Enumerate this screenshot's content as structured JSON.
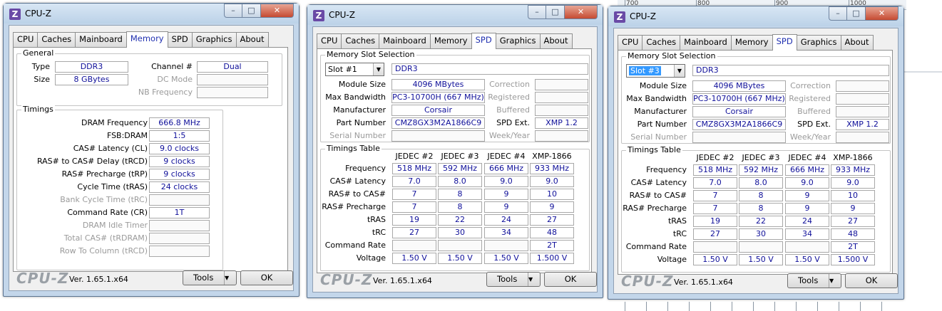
{
  "background": {
    "ruler_labels": [
      "700",
      "800",
      "900",
      "1000"
    ]
  },
  "windows": [
    {
      "title": "CPU-Z",
      "tabs": [
        "CPU",
        "Caches",
        "Mainboard",
        "Memory",
        "SPD",
        "Graphics",
        "About"
      ],
      "active_tab": "Memory",
      "general": {
        "label": "General",
        "type_label": "Type",
        "type_value": "DDR3",
        "size_label": "Size",
        "size_value": "8 GBytes",
        "channel_label": "Channel #",
        "channel_value": "Dual",
        "dc_mode_label": "DC Mode",
        "dc_mode_value": "",
        "nb_freq_label": "NB Frequency",
        "nb_freq_value": ""
      },
      "timings": {
        "label": "Timings",
        "rows": [
          {
            "label": "DRAM Frequency",
            "value": "666.8 MHz",
            "dim": false
          },
          {
            "label": "FSB:DRAM",
            "value": "1:5",
            "dim": false
          },
          {
            "label": "CAS# Latency (CL)",
            "value": "9.0 clocks",
            "dim": false
          },
          {
            "label": "RAS# to CAS# Delay (tRCD)",
            "value": "9 clocks",
            "dim": false
          },
          {
            "label": "RAS# Precharge (tRP)",
            "value": "9 clocks",
            "dim": false
          },
          {
            "label": "Cycle Time (tRAS)",
            "value": "24 clocks",
            "dim": false
          },
          {
            "label": "Bank Cycle Time (tRC)",
            "value": "",
            "dim": true
          },
          {
            "label": "Command Rate (CR)",
            "value": "1T",
            "dim": false
          },
          {
            "label": "DRAM Idle Timer",
            "value": "",
            "dim": true
          },
          {
            "label": "Total CAS# (tRDRAM)",
            "value": "",
            "dim": true
          },
          {
            "label": "Row To Column (tRCD)",
            "value": "",
            "dim": true
          }
        ]
      },
      "footer": {
        "logo": "CPU-Z",
        "version": "Ver. 1.65.1.x64",
        "tools_label": "Tools",
        "ok_label": "OK"
      }
    },
    {
      "title": "CPU-Z",
      "tabs": [
        "CPU",
        "Caches",
        "Mainboard",
        "Memory",
        "SPD",
        "Graphics",
        "About"
      ],
      "active_tab": "SPD",
      "slot_selection": {
        "label": "Memory Slot Selection",
        "slot_value": "Slot #1",
        "type_value": "DDR3",
        "module_size_label": "Module Size",
        "module_size_value": "4096 MBytes",
        "max_bw_label": "Max Bandwidth",
        "max_bw_value": "PC3-10700H (667 MHz)",
        "manufacturer_label": "Manufacturer",
        "manufacturer_value": "Corsair",
        "part_number_label": "Part Number",
        "part_number_value": "CMZ8GX3M2A1866C9",
        "serial_label": "Serial Number",
        "serial_value": "",
        "correction_label": "Correction",
        "correction_value": "",
        "registered_label": "Registered",
        "registered_value": "",
        "buffered_label": "Buffered",
        "buffered_value": "",
        "spd_ext_label": "SPD Ext.",
        "spd_ext_value": "XMP 1.2",
        "week_year_label": "Week/Year",
        "week_year_value": ""
      },
      "timings_table": {
        "label": "Timings Table",
        "columns": [
          "JEDEC #2",
          "JEDEC #3",
          "JEDEC #4",
          "XMP-1866"
        ],
        "rows": [
          {
            "label": "Frequency",
            "values": [
              "518 MHz",
              "592 MHz",
              "666 MHz",
              "933 MHz"
            ]
          },
          {
            "label": "CAS# Latency",
            "values": [
              "7.0",
              "8.0",
              "9.0",
              "9.0"
            ]
          },
          {
            "label": "RAS# to CAS#",
            "values": [
              "7",
              "8",
              "9",
              "10"
            ]
          },
          {
            "label": "RAS# Precharge",
            "values": [
              "7",
              "8",
              "9",
              "9"
            ]
          },
          {
            "label": "tRAS",
            "values": [
              "19",
              "22",
              "24",
              "27"
            ]
          },
          {
            "label": "tRC",
            "values": [
              "27",
              "30",
              "34",
              "48"
            ]
          },
          {
            "label": "Command Rate",
            "values": [
              "",
              "",
              "",
              "2T"
            ]
          },
          {
            "label": "Voltage",
            "values": [
              "1.50 V",
              "1.50 V",
              "1.50 V",
              "1.500 V"
            ]
          }
        ]
      },
      "footer": {
        "logo": "CPU-Z",
        "version": "Ver. 1.65.1.x64",
        "tools_label": "Tools",
        "ok_label": "OK"
      }
    },
    {
      "title": "CPU-Z",
      "tabs": [
        "CPU",
        "Caches",
        "Mainboard",
        "Memory",
        "SPD",
        "Graphics",
        "About"
      ],
      "active_tab": "SPD",
      "slot_selection": {
        "label": "Memory Slot Selection",
        "slot_value": "Slot #3",
        "type_value": "DDR3",
        "module_size_label": "Module Size",
        "module_size_value": "4096 MBytes",
        "max_bw_label": "Max Bandwidth",
        "max_bw_value": "PC3-10700H (667 MHz)",
        "manufacturer_label": "Manufacturer",
        "manufacturer_value": "Corsair",
        "part_number_label": "Part Number",
        "part_number_value": "CMZ8GX3M2A1866C9",
        "serial_label": "Serial Number",
        "serial_value": "",
        "correction_label": "Correction",
        "correction_value": "",
        "registered_label": "Registered",
        "registered_value": "",
        "buffered_label": "Buffered",
        "buffered_value": "",
        "spd_ext_label": "SPD Ext.",
        "spd_ext_value": "XMP 1.2",
        "week_year_label": "Week/Year",
        "week_year_value": ""
      },
      "timings_table": {
        "label": "Timings Table",
        "columns": [
          "JEDEC #2",
          "JEDEC #3",
          "JEDEC #4",
          "XMP-1866"
        ],
        "rows": [
          {
            "label": "Frequency",
            "values": [
              "518 MHz",
              "592 MHz",
              "666 MHz",
              "933 MHz"
            ]
          },
          {
            "label": "CAS# Latency",
            "values": [
              "7.0",
              "8.0",
              "9.0",
              "9.0"
            ]
          },
          {
            "label": "RAS# to CAS#",
            "values": [
              "7",
              "8",
              "9",
              "10"
            ]
          },
          {
            "label": "RAS# Precharge",
            "values": [
              "7",
              "8",
              "9",
              "9"
            ]
          },
          {
            "label": "tRAS",
            "values": [
              "19",
              "22",
              "24",
              "27"
            ]
          },
          {
            "label": "tRC",
            "values": [
              "27",
              "30",
              "34",
              "48"
            ]
          },
          {
            "label": "Command Rate",
            "values": [
              "",
              "",
              "",
              "2T"
            ]
          },
          {
            "label": "Voltage",
            "values": [
              "1.50 V",
              "1.50 V",
              "1.50 V",
              "1.500 V"
            ]
          }
        ]
      },
      "footer": {
        "logo": "CPU-Z",
        "version": "Ver. 1.65.1.x64",
        "tools_label": "Tools",
        "ok_label": "OK"
      }
    }
  ]
}
